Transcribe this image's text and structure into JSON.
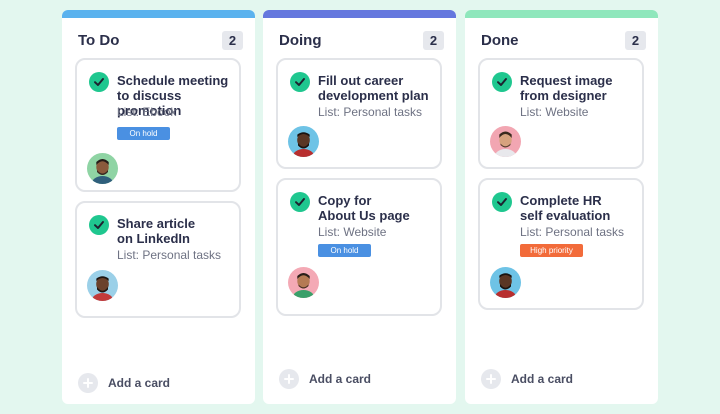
{
  "colors": {
    "background": "#e3f7ef",
    "todo_bar": "#5ab2ee",
    "doing_bar": "#6578de",
    "done_bar": "#8fe7bc",
    "check": "#1fc78f",
    "on_hold": "#4a90e2",
    "high_priority": "#f26b3a"
  },
  "columns": [
    {
      "title": "To Do",
      "count": "2",
      "add_label": "Add a card",
      "cards": [
        {
          "title_line1": "Schedule meeting",
          "title_line2": "to discuss promotion",
          "list": "List: Ebook",
          "tag": "On hold"
        },
        {
          "title_line1": "Share article",
          "title_line2": "on LinkedIn",
          "list": "List: Personal tasks"
        }
      ]
    },
    {
      "title": "Doing",
      "count": "2",
      "add_label": "Add a card",
      "cards": [
        {
          "title_line1": "Fill out career",
          "title_line2": "development plan",
          "list": "List: Personal tasks"
        },
        {
          "title_line1": "Copy for",
          "title_line2": "About Us page",
          "list": "List: Website",
          "tag": "On hold"
        }
      ]
    },
    {
      "title": "Done",
      "count": "2",
      "add_label": "Add a card",
      "cards": [
        {
          "title_line1": "Request image",
          "title_line2": "from designer",
          "list": "List: Website"
        },
        {
          "title_line1": "Complete HR",
          "title_line2": "self evaluation",
          "list": "List: Personal tasks",
          "tag": "High priority"
        }
      ]
    }
  ]
}
